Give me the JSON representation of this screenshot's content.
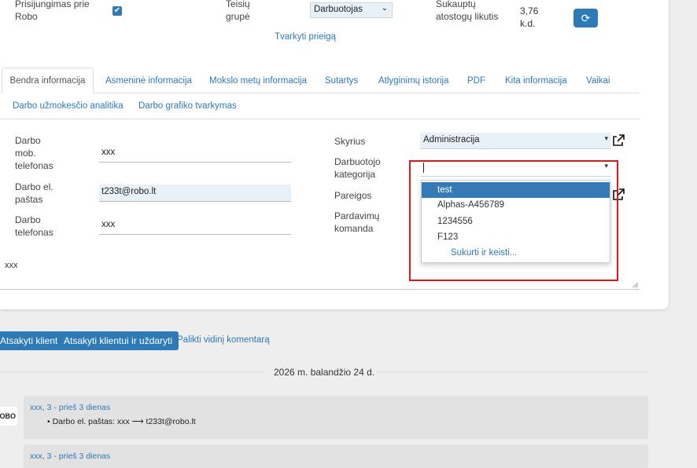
{
  "header": {
    "login_label": "Prisijungimas prie Robo",
    "rights_group_label": "Teisių grupė",
    "rights_group_value": "Darbuotojas",
    "edit_access_link": "Tvarkyti prieigą",
    "vacation_label": "Sukauptų atostogų likutis",
    "vacation_value": "3,76",
    "vacation_unit": "k.d."
  },
  "tabs": [
    {
      "label": "Bendra informacija"
    },
    {
      "label": "Asmeninė informacija"
    },
    {
      "label": "Mokslo metų informacija"
    },
    {
      "label": "Sutartys"
    },
    {
      "label": "Atlyginimų istorija"
    },
    {
      "label": "PDF"
    },
    {
      "label": "Kita informacija"
    },
    {
      "label": "Vaikai"
    },
    {
      "label": "Darbo užmokesčio analitika"
    },
    {
      "label": "Darbo grafiko tvarkymas"
    }
  ],
  "form": {
    "mobile_label": "Darbo mob. telefonas",
    "mobile_value": "xxx",
    "email_label": "Darbo el. paštas",
    "email_value": "t233t@robo.lt",
    "phone_label": "Darbo telefonas",
    "phone_value": "xxx",
    "notes_value": "xxx",
    "department_label": "Skyrius",
    "department_value": "Administracija",
    "category_label": "Darbuotojo kategorija",
    "position_label": "Pareigos",
    "sales_team_label": "Pardavimų komanda"
  },
  "category_dropdown": {
    "options": [
      "test",
      "Alphas-A456789",
      "1234556",
      "F123"
    ],
    "active_index": 0,
    "create_label": "Sukurti ir keisti..."
  },
  "actions": {
    "reply_label": "Atsakyti klientui",
    "reply_close_label": "Atsakyti klientui ir uždaryti",
    "internal_comment_label": "Palikti vidinį komentarą"
  },
  "timeline": {
    "date": "2026 m. balandžio 24 d.",
    "entry_author": "xxx, 3",
    "entry_time": " - prieš 3 dienas",
    "entry_line": "Darbo el. paštas: xxx ⟶ t233t@robo.lt",
    "next_author": "xxx, 3",
    "next_time": " - prieš 3 dienas",
    "avatar_text": "ROBO"
  },
  "colors": {
    "primary": "#2c7ab8",
    "highlight": "#e0161b"
  }
}
